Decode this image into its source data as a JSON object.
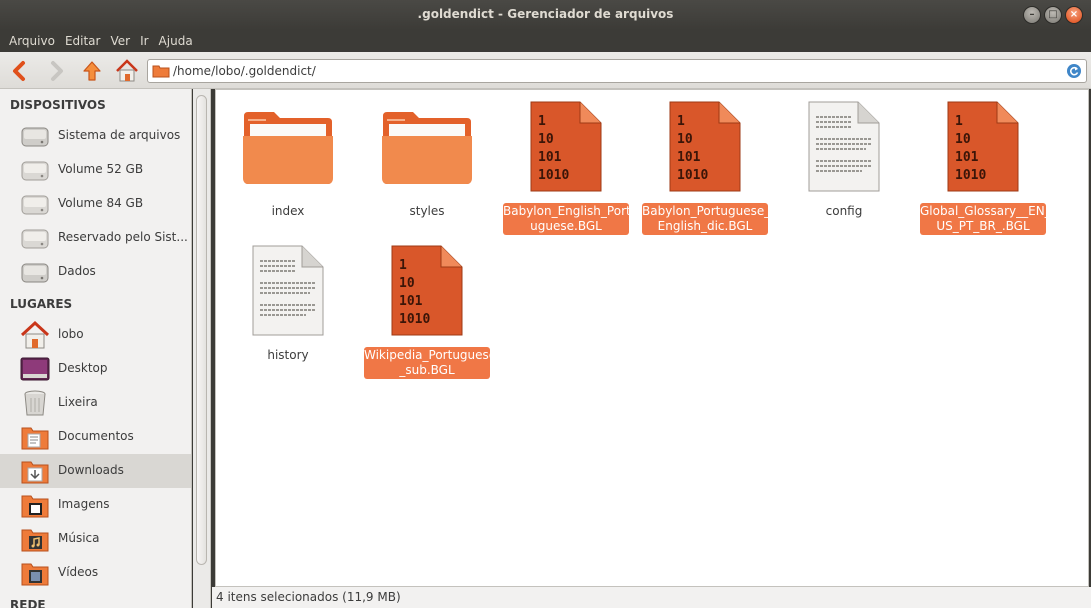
{
  "window": {
    "title": ".goldendict - Gerenciador de arquivos",
    "accent": "#f07746"
  },
  "menu": [
    "Arquivo",
    "Editar",
    "Ver",
    "Ir",
    "Ajuda"
  ],
  "location": {
    "path": "/home/lobo/.goldendict/"
  },
  "sidebar": {
    "devices_title": "DISPOSITIVOS",
    "devices": [
      {
        "label": "Sistema de arquivos",
        "icon": "drive-icon"
      },
      {
        "label": "Volume 52 GB",
        "icon": "drive-icon"
      },
      {
        "label": "Volume 84 GB",
        "icon": "drive-icon"
      },
      {
        "label": "Reservado pelo Sist...",
        "icon": "drive-icon"
      },
      {
        "label": "Dados",
        "icon": "drive-icon"
      }
    ],
    "places_title": "LUGARES",
    "places": [
      {
        "label": "lobo",
        "icon": "home-icon"
      },
      {
        "label": "Desktop",
        "icon": "desktop-icon"
      },
      {
        "label": "Lixeira",
        "icon": "trash-icon"
      },
      {
        "label": "Documentos",
        "icon": "documents-folder-icon"
      },
      {
        "label": "Downloads",
        "icon": "downloads-folder-icon",
        "selected": true
      },
      {
        "label": "Imagens",
        "icon": "pictures-folder-icon"
      },
      {
        "label": "Música",
        "icon": "music-folder-icon"
      },
      {
        "label": "Vídeos",
        "icon": "videos-folder-icon"
      }
    ],
    "network_title": "REDE"
  },
  "files": [
    {
      "name": "index",
      "type": "folder",
      "selected": false
    },
    {
      "name": "styles",
      "type": "folder",
      "selected": false
    },
    {
      "name": "Babylon_English_Port\nuguese.BGL",
      "type": "binary",
      "selected": true
    },
    {
      "name": "Babylon_Portuguese_\nEnglish_dic.BGL",
      "type": "binary",
      "selected": true
    },
    {
      "name": "config",
      "type": "text",
      "selected": false
    },
    {
      "name": "Global_Glossary__EN_\nUS_PT_BR_.BGL",
      "type": "binary",
      "selected": true
    },
    {
      "name": "history",
      "type": "text",
      "selected": false
    },
    {
      "name": "Wikipedia_Portuguese\n_sub.BGL",
      "type": "binary",
      "selected": true
    }
  ],
  "binary_icon_text": [
    "1",
    "10",
    "101",
    "1010"
  ],
  "status": "4 itens selecionados (11,9 MB)"
}
